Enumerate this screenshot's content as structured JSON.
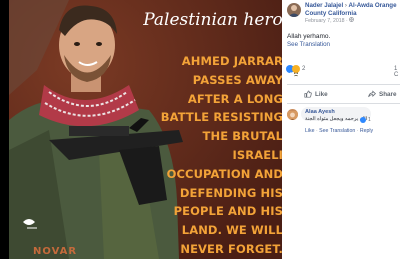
{
  "image": {
    "headline": "Palestinian hero",
    "message_lines": [
      "AHMED JARRAR",
      "PASSES AWAY",
      "AFTER A LONG",
      "BATTLE RESISTING",
      "THE BRUTAL",
      "ISRAELI",
      "OCCUPATION AND",
      "DEFENDING HIS",
      "PEOPLE AND HIS",
      "LAND. WE WILL",
      "NEVER FORGET."
    ],
    "bottom_text": "NOVAR"
  },
  "post": {
    "author": "Nader Jalajel",
    "separator": "›",
    "group": "Al-Awda Orange County California",
    "timestamp": "February 7, 2018 · ",
    "text": "Allah yerhamo.",
    "see_translation": "See Translation",
    "reaction_count": "2",
    "right_edge_text": "1 C",
    "like_label": "Like",
    "share_label": "Share"
  },
  "comment": {
    "author": "Alaa Ayesh",
    "text": "الله يرحمه ويجعل مثواه الجنة",
    "reaction_count": "1",
    "actions": [
      "Like",
      "See Translation",
      "Reply"
    ],
    "action_sep": "·"
  },
  "colors": {
    "link": "#365899",
    "photo_bg": "#5e2a1c",
    "message_orange": "#f3a338",
    "like_blue": "#2d88ff"
  }
}
